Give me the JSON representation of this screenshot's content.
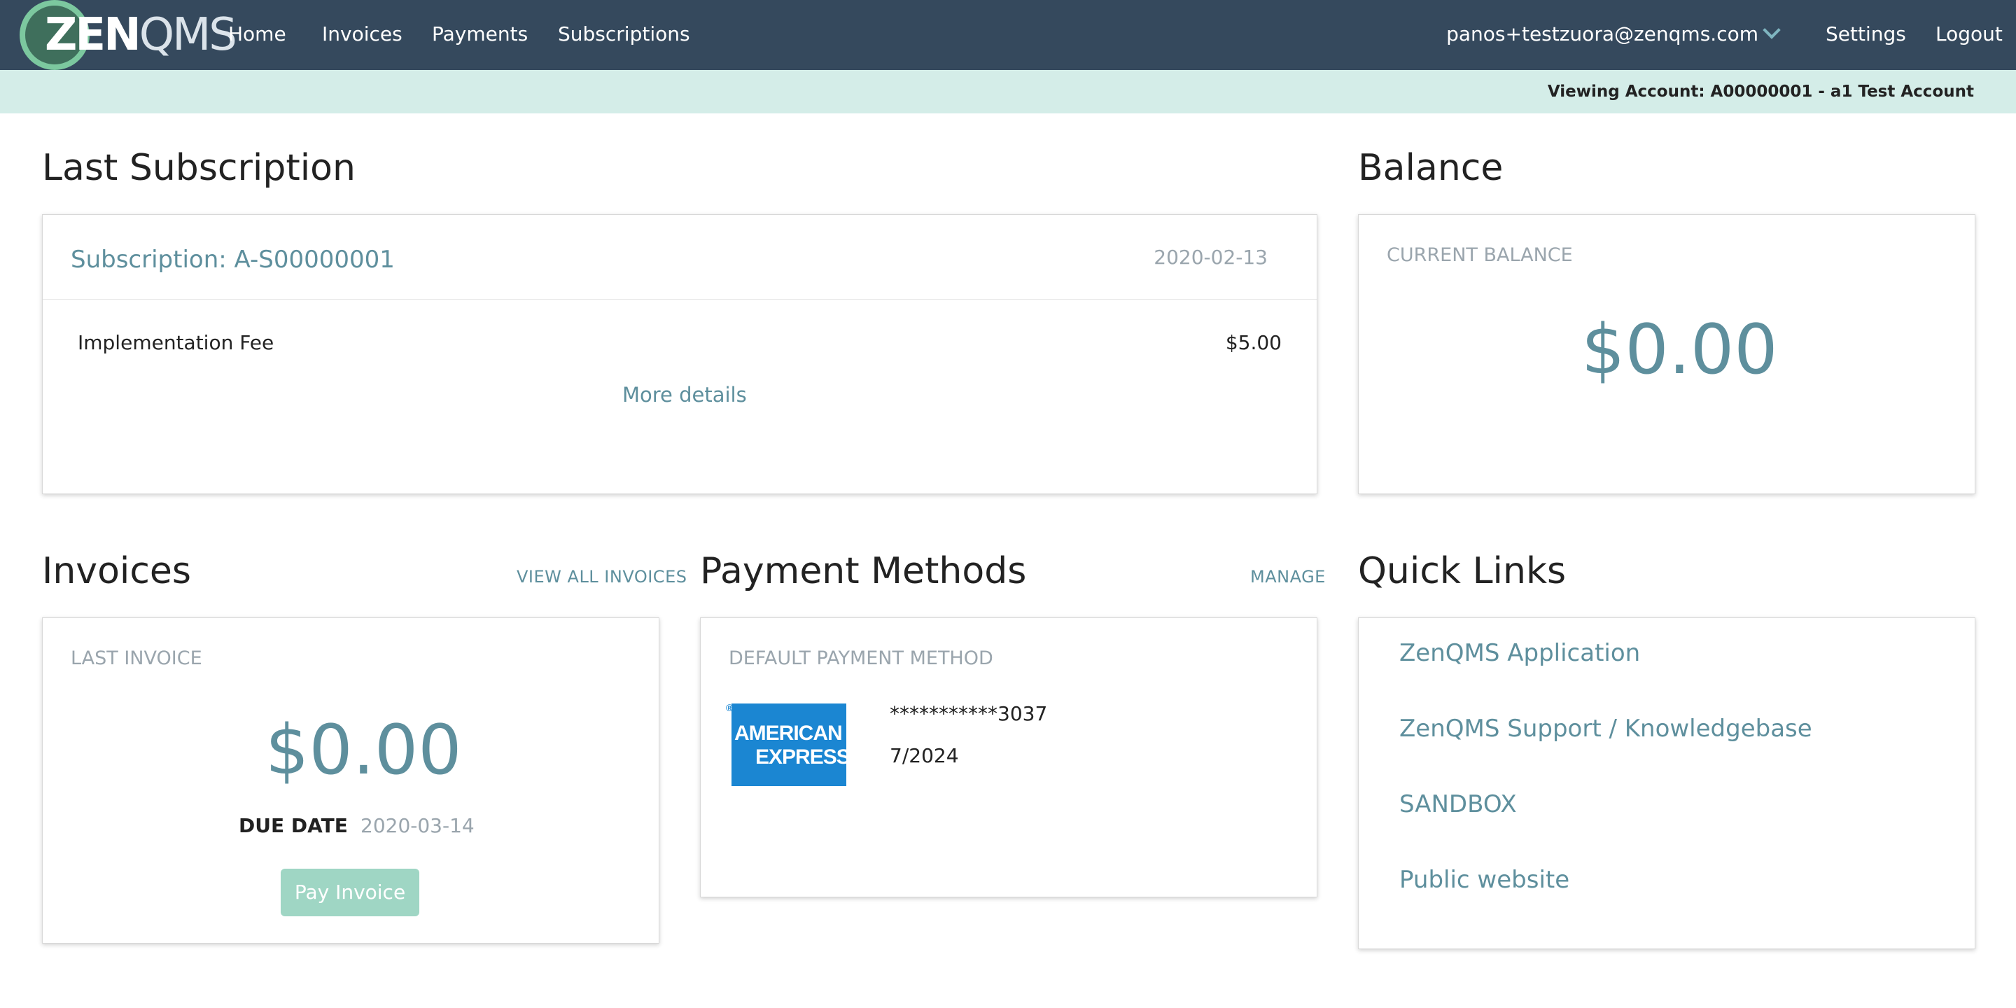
{
  "brand": {
    "logo_text_bold": "ZEN",
    "logo_text_light": "QMS"
  },
  "nav": {
    "home": "Home",
    "invoices": "Invoices",
    "payments": "Payments",
    "subscriptions": "Subscriptions",
    "user_email": "panos+testzuora@zenqms.com",
    "settings": "Settings",
    "logout": "Logout"
  },
  "account_bar": {
    "text": "Viewing Account: A00000001 - a1 Test Account"
  },
  "last_subscription": {
    "heading": "Last Subscription",
    "title": "Subscription: A-S00000001",
    "date": "2020-02-13",
    "item_name": "Implementation Fee",
    "item_amount": "$5.00",
    "more_details": "More details"
  },
  "balance": {
    "heading": "Balance",
    "label": "CURRENT BALANCE",
    "amount": "$0.00"
  },
  "invoices": {
    "heading": "Invoices",
    "view_all": "VIEW ALL INVOICES",
    "label": "LAST INVOICE",
    "amount": "$0.00",
    "due_label": "DUE DATE",
    "due_date": "2020-03-14",
    "pay_button": "Pay Invoice"
  },
  "payment_methods": {
    "heading": "Payment Methods",
    "manage": "MANAGE",
    "label": "DEFAULT PAYMENT METHOD",
    "card_brand_line1": "AMERICAN",
    "card_brand_line2": "EXPRESS",
    "card_number": "***********3037",
    "expiry": "7/2024"
  },
  "quick_links": {
    "heading": "Quick Links",
    "items": [
      "ZenQMS Application",
      "ZenQMS Support / Knowledgebase",
      "SANDBOX",
      "Public website"
    ]
  },
  "colors": {
    "navbar": "#35495d",
    "accent": "#5e8f9d",
    "account_bar": "#d4ede8",
    "pay_button": "#9fd6c4",
    "amex_blue": "#1b86d2"
  }
}
